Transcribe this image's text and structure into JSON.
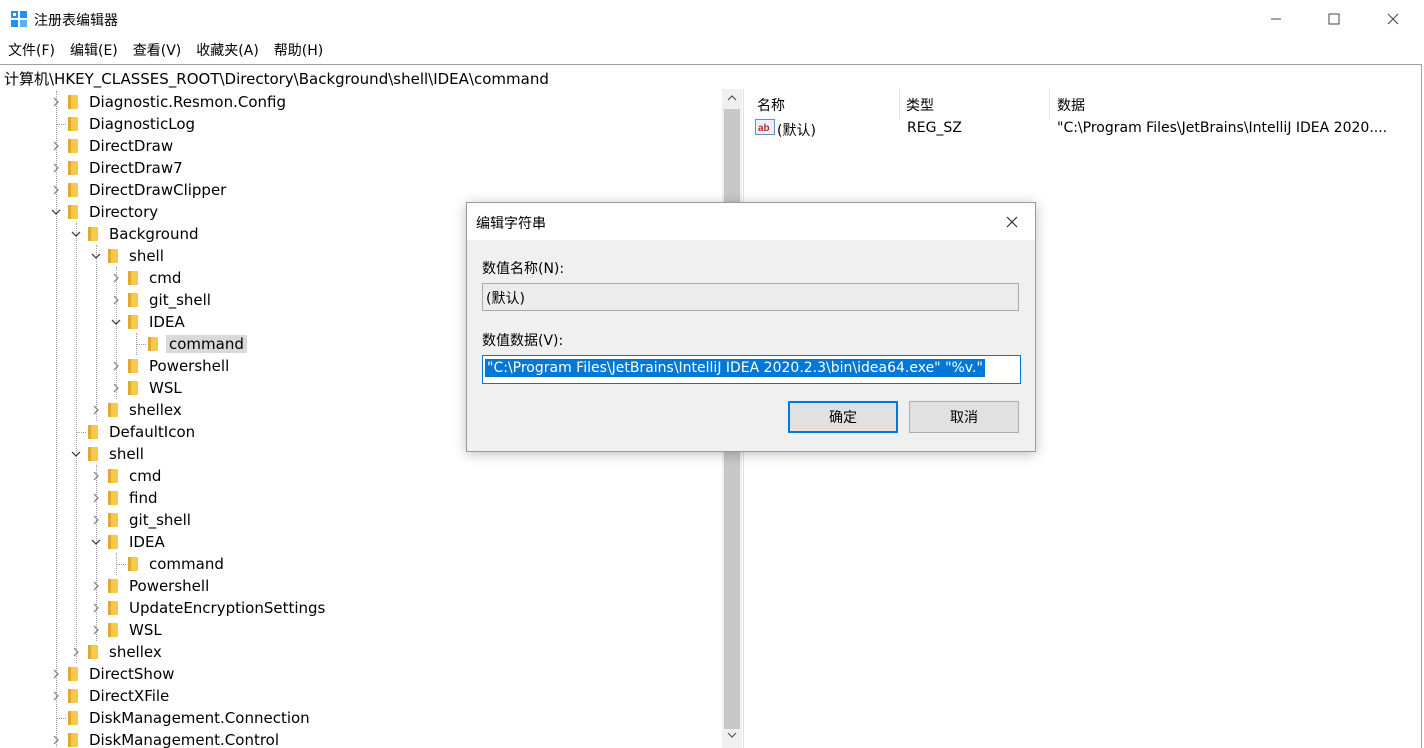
{
  "window": {
    "title": "注册表编辑器",
    "icon": "regedit-icon"
  },
  "menu": [
    "文件(F)",
    "编辑(E)",
    "查看(V)",
    "收藏夹(A)",
    "帮助(H)"
  ],
  "address": "计算机\\HKEY_CLASSES_ROOT\\Directory\\Background\\shell\\IDEA\\command",
  "tree": [
    {
      "label": "Diagnostic.Resmon.Config",
      "level": 0,
      "expander": "collapsed"
    },
    {
      "label": "DiagnosticLog",
      "level": 0,
      "expander": "none"
    },
    {
      "label": "DirectDraw",
      "level": 0,
      "expander": "collapsed"
    },
    {
      "label": "DirectDraw7",
      "level": 0,
      "expander": "collapsed"
    },
    {
      "label": "DirectDrawClipper",
      "level": 0,
      "expander": "collapsed"
    },
    {
      "label": "Directory",
      "level": 0,
      "expander": "expanded"
    },
    {
      "label": "Background",
      "level": 1,
      "expander": "expanded"
    },
    {
      "label": "shell",
      "level": 2,
      "expander": "expanded"
    },
    {
      "label": "cmd",
      "level": 3,
      "expander": "collapsed"
    },
    {
      "label": "git_shell",
      "level": 3,
      "expander": "collapsed"
    },
    {
      "label": "IDEA",
      "level": 3,
      "expander": "expanded"
    },
    {
      "label": "command",
      "level": 4,
      "expander": "none",
      "selected": true
    },
    {
      "label": "Powershell",
      "level": 3,
      "expander": "collapsed"
    },
    {
      "label": "WSL",
      "level": 3,
      "expander": "collapsed"
    },
    {
      "label": "shellex",
      "level": 2,
      "expander": "collapsed"
    },
    {
      "label": "DefaultIcon",
      "level": 1,
      "expander": "none"
    },
    {
      "label": "shell",
      "level": 1,
      "expander": "expanded"
    },
    {
      "label": "cmd",
      "level": 2,
      "expander": "collapsed"
    },
    {
      "label": "find",
      "level": 2,
      "expander": "collapsed"
    },
    {
      "label": "git_shell",
      "level": 2,
      "expander": "collapsed"
    },
    {
      "label": "IDEA",
      "level": 2,
      "expander": "expanded"
    },
    {
      "label": "command",
      "level": 3,
      "expander": "none"
    },
    {
      "label": "Powershell",
      "level": 2,
      "expander": "collapsed"
    },
    {
      "label": "UpdateEncryptionSettings",
      "level": 2,
      "expander": "collapsed"
    },
    {
      "label": "WSL",
      "level": 2,
      "expander": "collapsed"
    },
    {
      "label": "shellex",
      "level": 1,
      "expander": "collapsed"
    },
    {
      "label": "DirectShow",
      "level": 0,
      "expander": "collapsed"
    },
    {
      "label": "DirectXFile",
      "level": 0,
      "expander": "collapsed"
    },
    {
      "label": "DiskManagement.Connection",
      "level": 0,
      "expander": "none"
    },
    {
      "label": "DiskManagement.Control",
      "level": 0,
      "expander": "collapsed"
    }
  ],
  "list": {
    "columns": [
      "名称",
      "类型",
      "数据"
    ],
    "rows": [
      {
        "name": "(默认)",
        "type": "REG_SZ",
        "data": "\"C:\\Program Files\\JetBrains\\IntelliJ IDEA 2020....",
        "icon": "string-value-icon"
      }
    ]
  },
  "dialog": {
    "title": "编辑字符串",
    "name_label": "数值名称(N):",
    "name_value": "(默认)",
    "data_label": "数值数据(V):",
    "data_value": "\"C:\\Program Files\\JetBrains\\IntelliJ IDEA 2020.2.3\\bin\\idea64.exe\" \"%v.\"",
    "ok_label": "确定",
    "cancel_label": "取消"
  },
  "colors": {
    "accent": "#0078d7",
    "folder": "#f7c948",
    "selection": "#d9d9d9"
  }
}
